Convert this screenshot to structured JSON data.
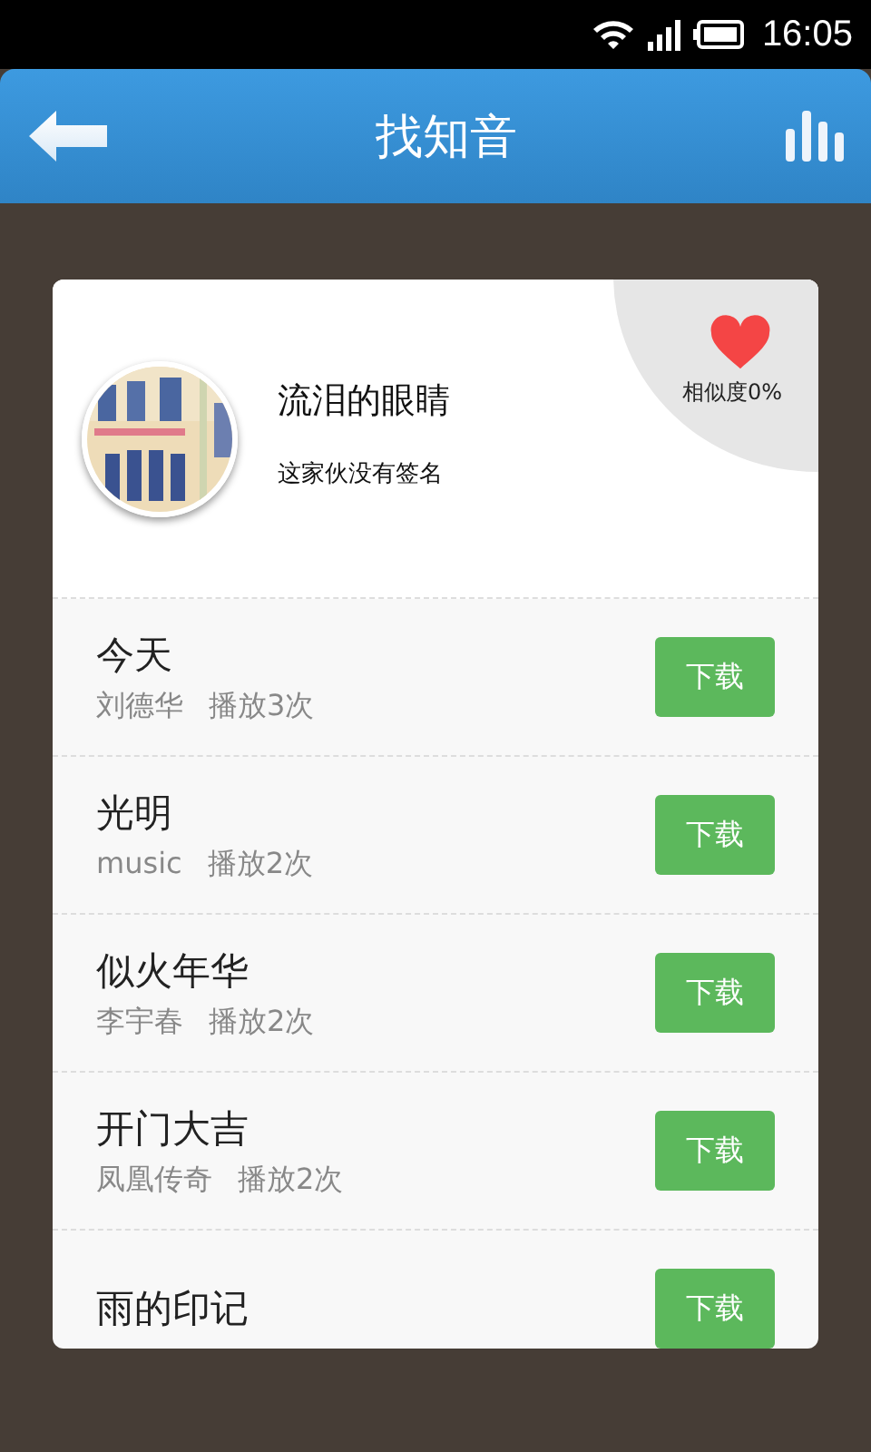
{
  "status_bar": {
    "time": "16:05"
  },
  "header": {
    "title": "找知音"
  },
  "profile": {
    "name": "流泪的眼睛",
    "signature": "这家伙没有签名",
    "similarity": "相似度0%"
  },
  "songs": [
    {
      "title": "今天",
      "artist": "刘德华",
      "plays": "播放3次",
      "button": "下载"
    },
    {
      "title": "光明",
      "artist": "music",
      "plays": "播放2次",
      "button": "下载"
    },
    {
      "title": "似火年华",
      "artist": "李宇春",
      "plays": "播放2次",
      "button": "下载"
    },
    {
      "title": "开门大吉",
      "artist": "凤凰传奇",
      "plays": "播放2次",
      "button": "下载"
    },
    {
      "title": "雨的印记",
      "button": "下载"
    }
  ]
}
